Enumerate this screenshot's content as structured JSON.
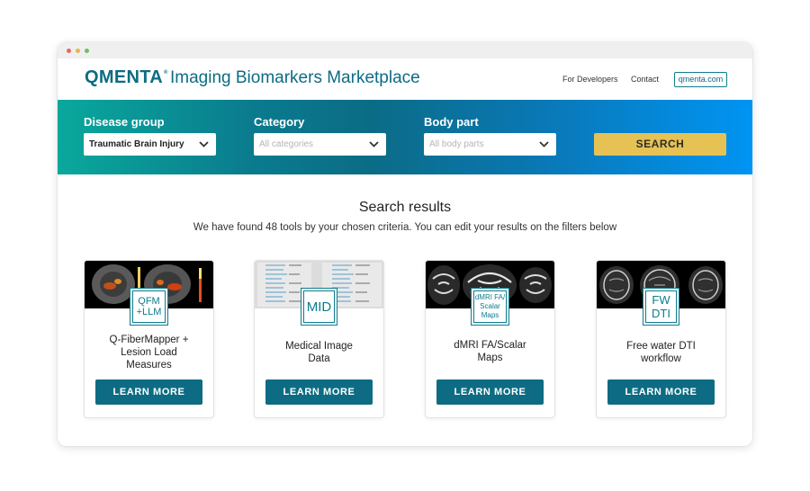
{
  "header": {
    "logo": "QMENTA",
    "logo_mark": "®",
    "app_title": "Imaging Biomarkers Marketplace",
    "nav": {
      "developers": "For Developers",
      "contact": "Contact",
      "site": "qmenta.com"
    }
  },
  "filters": {
    "disease_group": {
      "label": "Disease group",
      "value": "Traumatic Brain Injury"
    },
    "category": {
      "label": "Category",
      "placeholder": "All categories"
    },
    "body_part": {
      "label": "Body part",
      "placeholder": "All body parts"
    },
    "search_label": "SEARCH"
  },
  "results": {
    "title": "Search results",
    "subtitle": "We have found 48 tools by your chosen criteria. You can edit your results on the filters below"
  },
  "cards": [
    {
      "badge": [
        "QFM",
        "+LLM"
      ],
      "name": [
        "Q-FiberMapper +",
        "Lesion Load",
        "Measures"
      ],
      "button": "LEARN MORE"
    },
    {
      "badge": [
        "MID"
      ],
      "name": [
        "Medical Image",
        "Data"
      ],
      "button": "LEARN MORE"
    },
    {
      "badge": [
        "dMRI FA/",
        "Scalar",
        "Maps"
      ],
      "name": [
        "dMRI FA/Scalar",
        "Maps"
      ],
      "button": "LEARN MORE"
    },
    {
      "badge": [
        "FW",
        "DTI"
      ],
      "name": [
        "Free water DTI",
        "workflow"
      ],
      "button": "LEARN MORE"
    }
  ],
  "colors": {
    "brand": "#0d6c83",
    "search_button": "#e6c254",
    "banner_start": "#0aa89c",
    "banner_end": "#0094f3"
  },
  "icons": [
    "chevron-down-icon"
  ]
}
